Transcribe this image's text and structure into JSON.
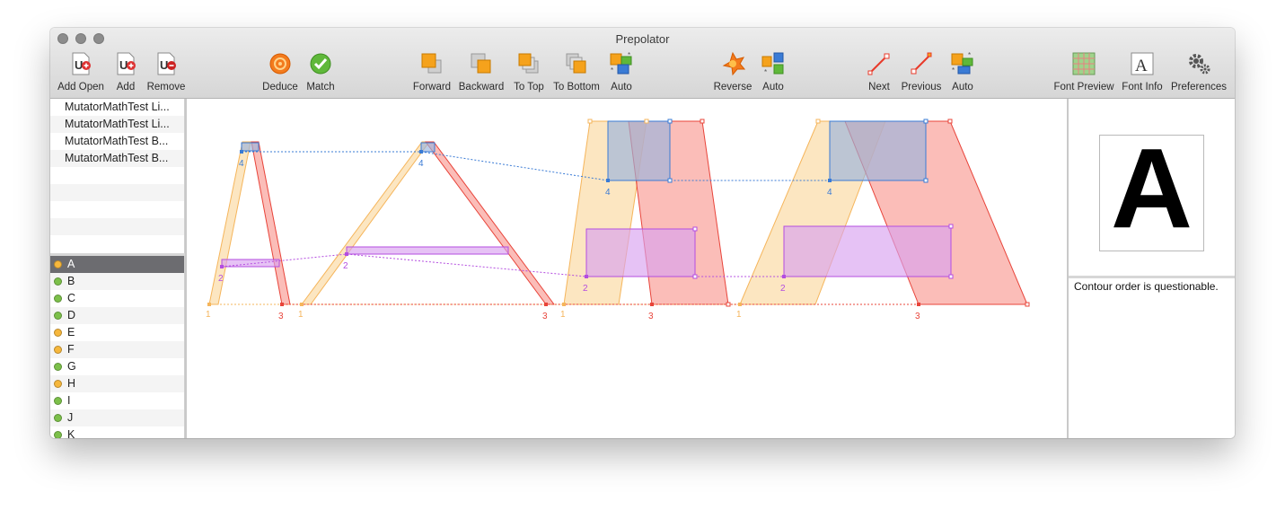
{
  "window": {
    "title": "Prepolator"
  },
  "toolbar": [
    {
      "label": "Add Open",
      "icon": "document-add-open-icon"
    },
    {
      "label": "Add",
      "icon": "document-add-icon"
    },
    {
      "label": "Remove",
      "icon": "document-remove-icon"
    },
    {
      "label": "Deduce",
      "icon": "deduce-icon"
    },
    {
      "label": "Match",
      "icon": "match-checkmark-icon"
    },
    {
      "label": "Forward",
      "icon": "bring-forward-icon"
    },
    {
      "label": "Backward",
      "icon": "send-backward-icon"
    },
    {
      "label": "To Top",
      "icon": "bring-to-top-icon"
    },
    {
      "label": "To Bottom",
      "icon": "send-to-bottom-icon"
    },
    {
      "label": "Auto",
      "icon": "auto-order-icon"
    },
    {
      "label": "Reverse",
      "icon": "reverse-direction-icon"
    },
    {
      "label": "Auto",
      "icon": "auto-direction-icon"
    },
    {
      "label": "Next",
      "icon": "next-start-point-icon"
    },
    {
      "label": "Previous",
      "icon": "previous-start-point-icon"
    },
    {
      "label": "Auto",
      "icon": "auto-start-point-icon"
    },
    {
      "label": "Font Preview",
      "icon": "font-preview-grid-icon"
    },
    {
      "label": "Font Info",
      "icon": "font-info-icon"
    },
    {
      "label": "Preferences",
      "icon": "gear-icon"
    }
  ],
  "fonts": [
    "MutatorMathTest Li...",
    "MutatorMathTest Li...",
    "MutatorMathTest B...",
    "MutatorMathTest B..."
  ],
  "glyphs": [
    {
      "name": "A",
      "status": "warning",
      "selected": true
    },
    {
      "name": "B",
      "status": "ok"
    },
    {
      "name": "C",
      "status": "ok"
    },
    {
      "name": "D",
      "status": "ok"
    },
    {
      "name": "E",
      "status": "warning"
    },
    {
      "name": "F",
      "status": "warning"
    },
    {
      "name": "G",
      "status": "ok"
    },
    {
      "name": "H",
      "status": "warning"
    },
    {
      "name": "I",
      "status": "ok"
    },
    {
      "name": "J",
      "status": "ok"
    },
    {
      "name": "K",
      "status": "ok"
    }
  ],
  "status_colors": {
    "ok": "#7cc04a",
    "warning": "#f6b73c"
  },
  "contour_colors": {
    "c1": "#fbd9a0",
    "c2": "#d8a2f0",
    "c3": "#f99a92",
    "c4": "#9ab3dd"
  },
  "contour_labels": [
    "1",
    "2",
    "3",
    "4"
  ],
  "preview": {
    "glyph": "A"
  },
  "message": "Contour order is questionable."
}
